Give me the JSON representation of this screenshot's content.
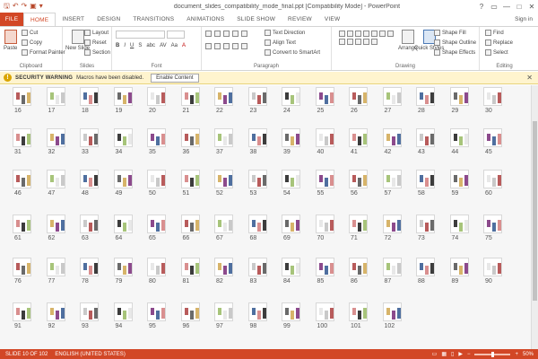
{
  "window": {
    "title": "document_slides_compatibility_mode_final.ppt  [Compatibility Mode] - PowerPoint",
    "controls": {
      "help": "?",
      "restore": "▭",
      "minimize": "—",
      "maximize": "□",
      "close": "✕"
    },
    "signin": "Sign in"
  },
  "qat": {
    "save": "🖫",
    "undo": "↶",
    "redo": "↷",
    "present": "▣",
    "more": "▾"
  },
  "tabs": [
    {
      "label": "FILE"
    },
    {
      "label": "HOME"
    },
    {
      "label": "INSERT"
    },
    {
      "label": "DESIGN"
    },
    {
      "label": "TRANSITIONS"
    },
    {
      "label": "ANIMATIONS"
    },
    {
      "label": "SLIDE SHOW"
    },
    {
      "label": "REVIEW"
    },
    {
      "label": "VIEW"
    }
  ],
  "ribbon": {
    "clipboard": {
      "label": "Clipboard",
      "cut": "Cut",
      "copy": "Copy",
      "format_painter": "Format Painter",
      "paste": "Paste"
    },
    "slides": {
      "label": "Slides",
      "new_slide": "New Slide",
      "layout": "Layout",
      "reset": "Reset",
      "section": "Section"
    },
    "font": {
      "label": "Font",
      "buttons": [
        "B",
        "I",
        "U",
        "S",
        "abc",
        "AV",
        "Aa",
        "A"
      ]
    },
    "paragraph": {
      "label": "Paragraph",
      "text_direction": "Text Direction",
      "align_text": "Align Text",
      "convert_smartart": "Convert to SmartArt"
    },
    "drawing": {
      "label": "Drawing",
      "arrange": "Arrange",
      "quick_styles": "Quick Styles",
      "shape_fill": "Shape Fill",
      "shape_outline": "Shape Outline",
      "shape_effects": "Shape Effects"
    },
    "editing": {
      "label": "Editing",
      "find": "Find",
      "replace": "Replace",
      "select": "Select"
    }
  },
  "warning": {
    "title": "SECURITY WARNING",
    "message": "Macros have been disabled.",
    "button": "Enable Content",
    "close": "✕"
  },
  "slides": {
    "row_numbers": [
      [
        "16",
        "17",
        "18",
        "19",
        "20",
        "21",
        "22",
        "23",
        "24",
        "25",
        "26",
        "27",
        "28",
        "29",
        "30"
      ],
      [
        "31",
        "32",
        "33",
        "34",
        "35",
        "36",
        "37",
        "38",
        "39",
        "40",
        "41",
        "42",
        "43",
        "44",
        "45"
      ],
      [
        "46",
        "47",
        "48",
        "49",
        "50",
        "51",
        "52",
        "53",
        "54",
        "55",
        "56",
        "57",
        "58",
        "59",
        "60"
      ],
      [
        "61",
        "62",
        "63",
        "64",
        "65",
        "66",
        "67",
        "68",
        "69",
        "70",
        "71",
        "72",
        "73",
        "74",
        "75"
      ],
      [
        "76",
        "77",
        "78",
        "79",
        "80",
        "81",
        "82",
        "83",
        "84",
        "85",
        "86",
        "87",
        "88",
        "89",
        "90"
      ],
      [
        "91",
        "92",
        "93",
        "94",
        "95",
        "96",
        "97",
        "98",
        "99",
        "100",
        "101",
        "102"
      ]
    ]
  },
  "status": {
    "slide": "SLIDE 10 OF 102",
    "lang": "ENGLISH (UNITED STATES)",
    "zoom": "50%",
    "zoom_fraction": 0.5
  }
}
